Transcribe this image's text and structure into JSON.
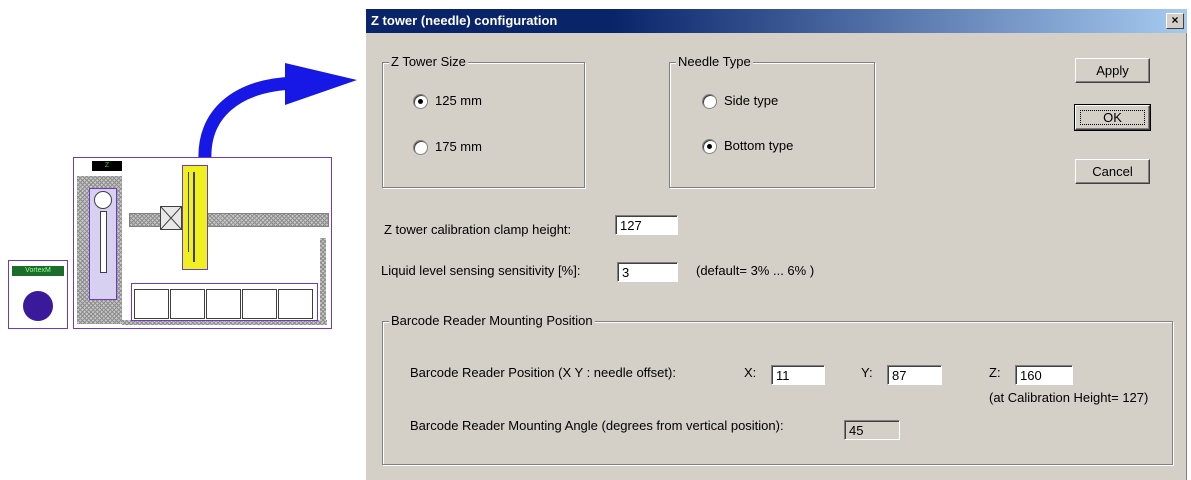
{
  "illustration": {
    "panel_label": "VortexM",
    "tower_label": "Z",
    "colors": {
      "frame": "#6e39c8",
      "needle": "#f0f020",
      "arrow": "#1818e6",
      "disc": "#3a1a9a"
    }
  },
  "dialog": {
    "title": "Z tower (needle) configuration",
    "close_symbol": "×",
    "z_tower_size": {
      "label": "Z Tower Size",
      "options": [
        {
          "label": "125 mm",
          "selected": true
        },
        {
          "label": "175 mm",
          "selected": false
        }
      ]
    },
    "needle_type": {
      "label": "Needle Type",
      "options": [
        {
          "label": "Side type",
          "selected": false
        },
        {
          "label": "Bottom type",
          "selected": true
        }
      ]
    },
    "buttons": {
      "apply": "Apply",
      "ok": "OK",
      "cancel": "Cancel"
    },
    "calibration_clamp": {
      "label": "Z tower calibration clamp height:",
      "value": "127"
    },
    "liquid_sensing": {
      "label": "Liquid level sensing sensitivity [%]:",
      "value": "3",
      "hint": "(default= 3% ... 6% )"
    },
    "barcode": {
      "group_label": "Barcode Reader Mounting Position",
      "position_label": "Barcode Reader Position (X Y : needle offset):",
      "x_label": "X:",
      "x_value": "11",
      "y_label": "Y:",
      "y_value": "87",
      "z_label": "Z:",
      "z_value": "160",
      "z_note": "(at Calibration Height= 127)",
      "angle_label": "Barcode Reader Mounting Angle (degrees from vertical position):",
      "angle_value": "45"
    }
  }
}
